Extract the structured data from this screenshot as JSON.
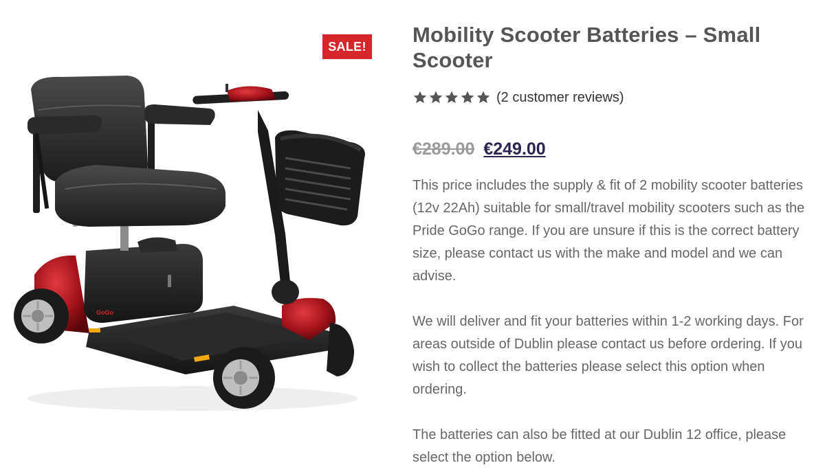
{
  "product": {
    "sale_badge": "SALE!",
    "title": "Mobility Scooter Batteries – Small Scooter",
    "rating": {
      "value": 5,
      "max": 5
    },
    "reviews_link": "(2 customer reviews)",
    "price": {
      "old": "€289.00",
      "new": "€249.00"
    },
    "description": [
      "This price includes the supply & fit of 2 mobility scooter batteries (12v 22Ah) suitable for small/travel mobility scooters such as the Pride GoGo range. If you are unsure if this is the correct battery size, please contact us with the make and model and we can advise.",
      "We will deliver and fit your batteries within 1-2 working days. For areas outside of Dublin please contact us before ordering. If you wish to collect the batteries please select this option when ordering.",
      "The batteries can also be fitted at our Dublin 12 office, please select the option below."
    ],
    "image": {
      "brand_text": "GoGo",
      "alt": "mobility-scooter"
    }
  },
  "colors": {
    "sale": "#d6262b",
    "title": "#555555",
    "star": "#555555",
    "price_new": "#2b2450",
    "price_old": "#9a9a9a",
    "body_text": "#666666",
    "scooter_red": "#a3121a"
  }
}
